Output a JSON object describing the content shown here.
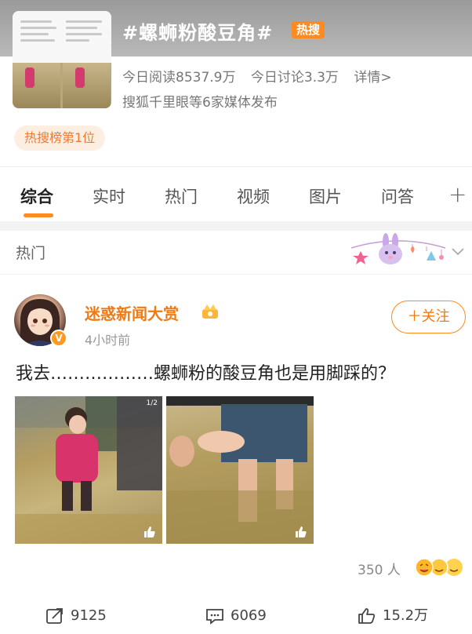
{
  "topic": {
    "title": "#螺蛳粉酸豆角#",
    "hot_tag": "热搜",
    "stats": [
      "今日阅读8537.9万",
      "今日讨论3.3万",
      "详情>"
    ],
    "publisher": "搜狐千里眼等6家媒体发布",
    "rank_chip": "热搜榜第1位"
  },
  "tabs": [
    "综合",
    "实时",
    "热门",
    "视频",
    "图片",
    "问答"
  ],
  "tabs_plus": "+",
  "section": {
    "title": "热门"
  },
  "post": {
    "author": "迷惑新闻大赏",
    "time": "4小时前",
    "follow": "＋关注",
    "text": "我去………………螺蛳粉的酸豆角也是用脚踩的？",
    "reactions": "350 人"
  },
  "actions": {
    "share": "9125",
    "comment": "6069",
    "like": "15.2万"
  },
  "colors": {
    "accent": "#ff8a1f",
    "author": "#f07a12",
    "chip_bg": "#fdeee2"
  }
}
